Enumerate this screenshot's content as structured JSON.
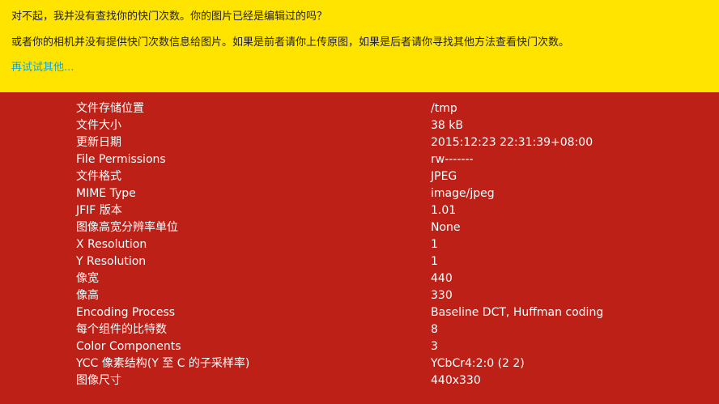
{
  "notice": {
    "message_line_1": "对不起，我并没有查找你的快门次数。你的图片已经是编辑过的吗？",
    "message_line_2": "或者你的相机并没有提供快门次数信息给图片。如果是前者请你上传原图，如果是后者请你寻找其他方法查看快门次数。",
    "retry_link": "再试试其他..."
  },
  "exif": [
    {
      "label": "文件存储位置",
      "value": "/tmp"
    },
    {
      "label": "文件大小",
      "value": "38 kB"
    },
    {
      "label": "更新日期",
      "value": "2015:12:23 22:31:39+08:00"
    },
    {
      "label": "File Permissions",
      "value": "rw-------"
    },
    {
      "label": "文件格式",
      "value": "JPEG"
    },
    {
      "label": "MIME Type",
      "value": "image/jpeg"
    },
    {
      "label": "JFIF 版本",
      "value": "1.01"
    },
    {
      "label": "图像高宽分辨率单位",
      "value": "None"
    },
    {
      "label": "X Resolution",
      "value": "1"
    },
    {
      "label": "Y Resolution",
      "value": "1"
    },
    {
      "label": "像宽",
      "value": "440"
    },
    {
      "label": "像高",
      "value": "330"
    },
    {
      "label": "Encoding Process",
      "value": "Baseline DCT, Huffman coding"
    },
    {
      "label": "每个组件的比特数",
      "value": "8"
    },
    {
      "label": "Color Components",
      "value": "3"
    },
    {
      "label": "YCC 像素结构(Y 至 C 的子采样率)",
      "value": "YCbCr4:2:0 (2 2)"
    },
    {
      "label": "图像尺寸",
      "value": "440x330"
    }
  ],
  "colors": {
    "notice_background": "#ffe400",
    "panel_background": "#bc2017",
    "link": "#19a6cc"
  }
}
